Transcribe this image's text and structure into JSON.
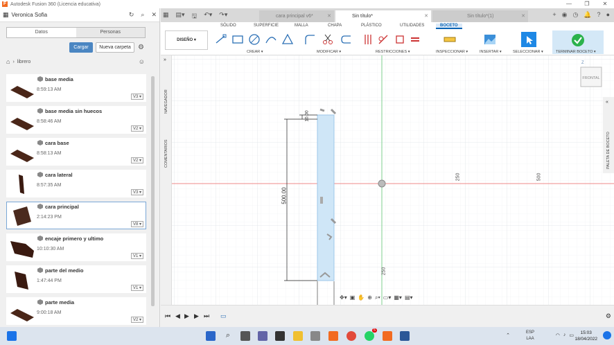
{
  "window": {
    "title": "Autodesk Fusion 360 (Licencia educativa)"
  },
  "panel": {
    "user": "Veronica Sofia",
    "tabs": [
      "Datos",
      "Personas"
    ],
    "upload": "Cargar",
    "new_folder": "Nueva carpeta",
    "breadcrumb": "librero",
    "files": [
      {
        "name": "base media",
        "time": "8:59:13 AM",
        "version": "V3 ▾",
        "color": "#4a2618"
      },
      {
        "name": "base media sin huecos",
        "time": "8:58:46 AM",
        "version": "V2 ▾",
        "color": "#4a2618"
      },
      {
        "name": "cara base",
        "time": "8:58:13 AM",
        "version": "V2 ▾",
        "color": "#4a2618"
      },
      {
        "name": "cara lateral",
        "time": "8:57:35 AM",
        "version": "V3 ▾",
        "color": "#3a1a10"
      },
      {
        "name": "cara principal",
        "time": "2:14:23 PM",
        "version": "V8 ▾",
        "color": "#4a2a1e"
      },
      {
        "name": "encaje primero y ultimo",
        "time": "10:10:30 AM",
        "version": "V1 ▾",
        "color": "#3a1a10"
      },
      {
        "name": "parte del medio",
        "time": "1:47:44 PM",
        "version": "V1 ▾",
        "color": "#3a1a10"
      },
      {
        "name": "parte media",
        "time": "9:00:18 AM",
        "version": "V2 ▾",
        "color": "#4a2618"
      }
    ]
  },
  "doc_tabs": [
    {
      "label": "cara principal v6*",
      "active": false
    },
    {
      "label": "Sin título*",
      "active": true
    },
    {
      "label": "Sin título*(1)",
      "active": false
    }
  ],
  "ribbon": {
    "tabs": [
      "SÓLIDO",
      "SUPERFICIE",
      "MALLA",
      "CHAPA",
      "PLÁSTICO",
      "UTILIDADES",
      "BOCETO"
    ],
    "active_tab": "BOCETO",
    "workspace": "DISEÑO ▾",
    "groups": [
      "CREAR ▾",
      "MODIFICAR ▾",
      "RESTRICCIONES ▾",
      "INSPECCIONAR ▾",
      "INSERTAR ▾",
      "SELECCIONAR ▾",
      "TERMINAR BOCETO ▾"
    ]
  },
  "side": {
    "navigator": "NAVEGADOR",
    "comments": "COMENTARIOS",
    "palette": "PALETA DE BOCETO"
  },
  "sketch": {
    "dim_main": "500.00",
    "dim_small": "10.00",
    "axis_250": "250",
    "axis_500": "500",
    "axis_v250": "250",
    "viewcube": "FRONTAL",
    "viewcube_axis": "Z"
  },
  "taskbar": {
    "lang1": "ESP",
    "lang2": "LAA",
    "time": "15:03",
    "date": "18/04/2022",
    "badge": "5"
  },
  "colors": {
    "accent": "#0a64b4",
    "finish": "#2bb24c",
    "upload": "#4b86c2"
  }
}
